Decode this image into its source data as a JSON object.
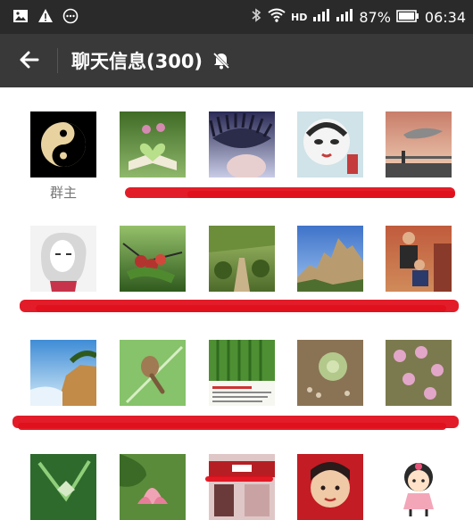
{
  "status_bar": {
    "battery": "87%",
    "time": "06:34",
    "network": "HD",
    "left_icons": [
      "image-icon",
      "warning-icon",
      "more-icon"
    ]
  },
  "app_bar": {
    "title": "聊天信息(300)",
    "back_icon": "back-arrow-icon",
    "mute_icon": "muted-bell-icon"
  },
  "members": [
    {
      "name": "群主",
      "icon": "yin-yang-avatar",
      "colors": [
        "#000000",
        "#e8d3a0"
      ]
    },
    {
      "name": "",
      "icon": "book-heart-avatar",
      "colors": [
        "#3f6b25",
        "#cfe6a8"
      ]
    },
    {
      "name": "",
      "icon": "eye-closeup-avatar",
      "colors": [
        "#c9cce6",
        "#2a2a55"
      ]
    },
    {
      "name": "",
      "icon": "opera-mask-avatar",
      "colors": [
        "#cfe3e8",
        "#c43c3c"
      ]
    },
    {
      "name": "",
      "icon": "whale-sky-avatar",
      "colors": [
        "#d9a18a",
        "#6b6b6b"
      ]
    },
    {
      "name": "",
      "icon": "girl-sketch-avatar",
      "colors": [
        "#f3f3f3",
        "#c6334a"
      ]
    },
    {
      "name": "",
      "icon": "berries-avatar",
      "colors": [
        "#4f8a2f",
        "#b3342f"
      ]
    },
    {
      "name": "",
      "icon": "park-path-avatar",
      "colors": [
        "#6c8d3a",
        "#a7c36b"
      ]
    },
    {
      "name": "",
      "icon": "mountain-avatar",
      "colors": [
        "#5e8fd6",
        "#b89c6f"
      ]
    },
    {
      "name": "",
      "icon": "family-photo-avatar",
      "colors": [
        "#9a4a3a",
        "#d08b5a"
      ]
    },
    {
      "name": "",
      "icon": "cliff-sea-avatar",
      "colors": [
        "#6aa9e0",
        "#c28b47"
      ]
    },
    {
      "name": "",
      "icon": "snail-leaf-avatar",
      "colors": [
        "#86c36a",
        "#a07a52"
      ]
    },
    {
      "name": "",
      "icon": "article-avatar",
      "colors": [
        "#4e8f33",
        "#f7f7f2"
      ]
    },
    {
      "name": "",
      "icon": "succulent-avatar",
      "colors": [
        "#8a7354",
        "#b3c98c"
      ]
    },
    {
      "name": "",
      "icon": "pink-flowers-avatar",
      "colors": [
        "#7a7a4e",
        "#e2a6c8"
      ]
    },
    {
      "name": "",
      "icon": "green-plant-avatar",
      "colors": [
        "#2f6a2d",
        "#d6e9c6"
      ]
    },
    {
      "name": "",
      "icon": "lotus-avatar",
      "colors": [
        "#5a8b3a",
        "#f1a3b6"
      ]
    },
    {
      "name": "",
      "icon": "shopfront-avatar",
      "colors": [
        "#b51f24",
        "#e0c7c7"
      ]
    },
    {
      "name": "",
      "icon": "child-portrait-avatar",
      "colors": [
        "#c31c24",
        "#f0c9a7"
      ]
    },
    {
      "name": "",
      "icon": "cartoon-girl-avatar",
      "colors": [
        "#f6e6ec",
        "#2a2a2a"
      ]
    }
  ],
  "redaction_color": "#e0101c"
}
